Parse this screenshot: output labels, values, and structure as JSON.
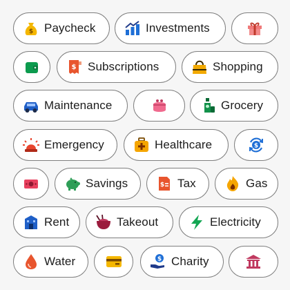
{
  "chips": {
    "paycheck": {
      "label": "Paycheck",
      "icon": "money-bag-icon"
    },
    "investments": {
      "label": "Investments",
      "icon": "bar-chart-trend-icon"
    },
    "gifts": {
      "label": "",
      "icon": "gift-icon"
    },
    "wallet": {
      "label": "",
      "icon": "wallet-icon"
    },
    "subscriptions": {
      "label": "Subscriptions",
      "icon": "receipt-icon"
    },
    "shopping": {
      "label": "Shopping",
      "icon": "shopping-bag-icon"
    },
    "maintenance": {
      "label": "Maintenance",
      "icon": "car-icon"
    },
    "purse": {
      "label": "",
      "icon": "coin-purse-icon"
    },
    "grocery": {
      "label": "Grocery",
      "icon": "grocery-bottle-icon"
    },
    "emergency": {
      "label": "Emergency",
      "icon": "siren-icon"
    },
    "healthcare": {
      "label": "Healthcare",
      "icon": "first-aid-kit-icon"
    },
    "exchange": {
      "label": "",
      "icon": "dollar-cycle-icon"
    },
    "cash": {
      "label": "",
      "icon": "banknote-icon"
    },
    "savings": {
      "label": "Savings",
      "icon": "piggy-bank-icon"
    },
    "tax": {
      "label": "Tax",
      "icon": "tax-document-icon"
    },
    "gas": {
      "label": "Gas",
      "icon": "flame-icon"
    },
    "rent": {
      "label": "Rent",
      "icon": "building-icon"
    },
    "takeout": {
      "label": "Takeout",
      "icon": "takeout-bowl-icon"
    },
    "electricity": {
      "label": "Electricity",
      "icon": "lightning-icon"
    },
    "water": {
      "label": "Water",
      "icon": "water-drop-icon"
    },
    "card": {
      "label": "",
      "icon": "credit-card-icon"
    },
    "charity": {
      "label": "Charity",
      "icon": "hand-coin-icon"
    },
    "bank": {
      "label": "",
      "icon": "bank-icon"
    }
  }
}
